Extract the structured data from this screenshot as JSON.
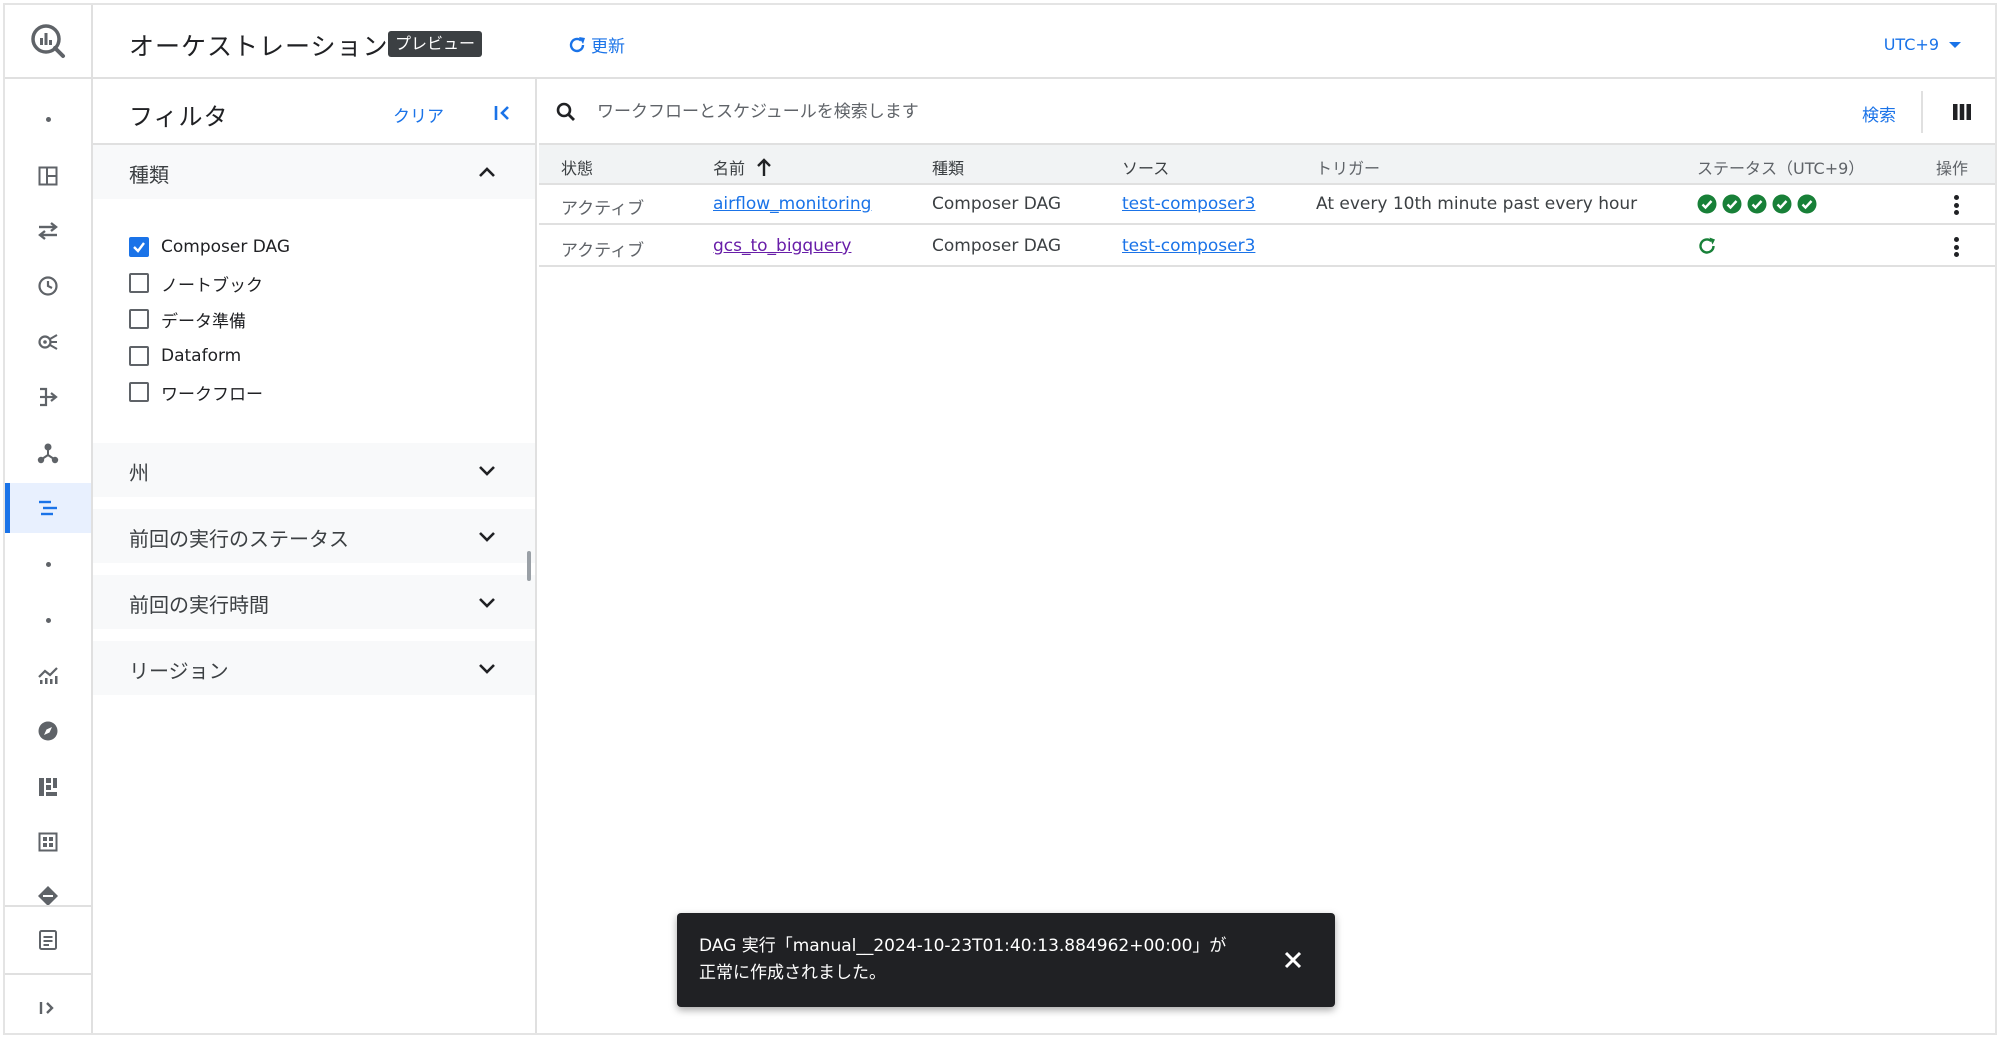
{
  "header": {
    "title": "オーケストレーション",
    "preview_badge": "プレビュー",
    "refresh_label": "更新",
    "timezone": "UTC+9"
  },
  "rail": {
    "items": [
      "bigquery-logo-icon",
      "dot-icon",
      "dashboard-icon",
      "transfer-icon",
      "schedule-icon",
      "analytics-hub-icon",
      "dataflow-icon",
      "partner-center-icon",
      "orchestration-icon",
      "dot-icon",
      "dot-icon",
      "monitoring-icon",
      "explore-icon",
      "data-canvas-icon",
      "table-icon",
      "diamond-icon",
      "release-notes-icon",
      "expand-rail-icon"
    ],
    "active": "orchestration-icon"
  },
  "filter": {
    "title": "フィルタ",
    "clear_label": "クリア",
    "type_section": {
      "label": "種類",
      "options": [
        {
          "label": "Composer DAG",
          "checked": true
        },
        {
          "label": "ノートブック",
          "checked": false
        },
        {
          "label": "データ準備",
          "checked": false
        },
        {
          "label": "Dataform",
          "checked": false
        },
        {
          "label": "ワークフロー",
          "checked": false
        }
      ]
    },
    "sections": [
      "州",
      "前回の実行のステータス",
      "前回の実行時間",
      "リージョン"
    ]
  },
  "search": {
    "placeholder": "ワークフローとスケジュールを検索します",
    "value": "",
    "button_label": "検索"
  },
  "table": {
    "columns": [
      "状態",
      "名前",
      "種類",
      "ソース",
      "トリガー",
      "ステータス（UTC+9）",
      "操作"
    ],
    "sort_column": "名前",
    "sort_direction": "ascending",
    "rows": [
      {
        "state": "アクティブ",
        "name": "airflow_monitoring",
        "type": "Composer DAG",
        "source": "test-composer3",
        "trigger": "At every 10th minute past every hour",
        "statuses": [
          "success",
          "success",
          "success",
          "success",
          "success"
        ]
      },
      {
        "state": "アクティブ",
        "name": "gcs_to_bigquery",
        "type": "Composer DAG",
        "source": "test-composer3",
        "trigger": "",
        "statuses": [
          "running"
        ]
      }
    ]
  },
  "snackbar": {
    "message": "DAG 実行「manual__2024-10-23T01:40:13.884962+00:00」が正常に作成されました。"
  },
  "colors": {
    "accent": "#1a73e8",
    "success": "#188038",
    "visited_link": "#681da8",
    "snackbar_bg": "#202124"
  }
}
